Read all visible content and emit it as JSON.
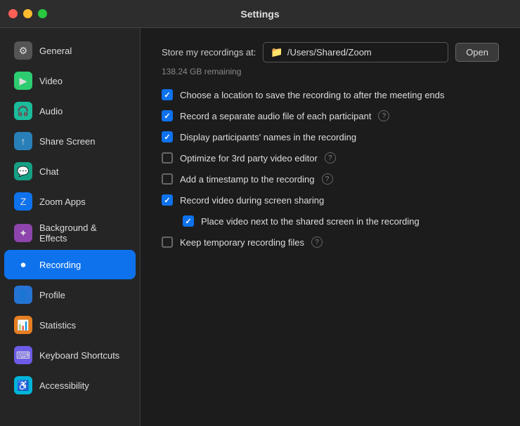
{
  "titleBar": {
    "title": "Settings"
  },
  "sidebar": {
    "items": [
      {
        "id": "general",
        "label": "General",
        "icon": "⚙",
        "iconClass": "icon-gray",
        "active": false
      },
      {
        "id": "video",
        "label": "Video",
        "icon": "▶",
        "iconClass": "icon-green",
        "active": false
      },
      {
        "id": "audio",
        "label": "Audio",
        "icon": "🎧",
        "iconClass": "icon-teal",
        "active": false
      },
      {
        "id": "share-screen",
        "label": "Share Screen",
        "icon": "↑",
        "iconClass": "icon-blue-dark",
        "active": false
      },
      {
        "id": "chat",
        "label": "Chat",
        "icon": "💬",
        "iconClass": "icon-teal2",
        "active": false
      },
      {
        "id": "zoom-apps",
        "label": "Zoom Apps",
        "icon": "Z",
        "iconClass": "icon-blue",
        "active": false
      },
      {
        "id": "background-effects",
        "label": "Background & Effects",
        "icon": "✦",
        "iconClass": "icon-purple",
        "active": false
      },
      {
        "id": "recording",
        "label": "Recording",
        "icon": "⏺",
        "iconClass": "icon-blue",
        "active": true
      },
      {
        "id": "profile",
        "label": "Profile",
        "icon": "👤",
        "iconClass": "icon-blue2",
        "active": false
      },
      {
        "id": "statistics",
        "label": "Statistics",
        "icon": "📊",
        "iconClass": "icon-orange",
        "active": false
      },
      {
        "id": "keyboard-shortcuts",
        "label": "Keyboard Shortcuts",
        "icon": "⌨",
        "iconClass": "icon-violet",
        "active": false
      },
      {
        "id": "accessibility",
        "label": "Accessibility",
        "icon": "♿",
        "iconClass": "icon-cyan",
        "active": false
      }
    ]
  },
  "content": {
    "storageLabel": "Store my recordings at:",
    "storagePath": "/Users/Shared/Zoom",
    "storageRemaining": "138.24 GB remaining",
    "openButton": "Open",
    "options": [
      {
        "id": "opt1",
        "text": "Choose a location to save the recording to after the meeting ends",
        "checked": true,
        "hasHelp": false,
        "indented": false
      },
      {
        "id": "opt2",
        "text": "Record a separate audio file of each participant",
        "checked": true,
        "hasHelp": true,
        "indented": false
      },
      {
        "id": "opt3",
        "text": "Display participants' names in the recording",
        "checked": true,
        "hasHelp": false,
        "indented": false
      },
      {
        "id": "opt4",
        "text": "Optimize for 3rd party video editor",
        "checked": false,
        "hasHelp": true,
        "indented": false
      },
      {
        "id": "opt5",
        "text": "Add a timestamp to the recording",
        "checked": false,
        "hasHelp": true,
        "indented": false
      },
      {
        "id": "opt6",
        "text": "Record video during screen sharing",
        "checked": true,
        "hasHelp": false,
        "indented": false
      },
      {
        "id": "opt7",
        "text": "Place video next to the shared screen in the recording",
        "checked": true,
        "hasHelp": false,
        "indented": true
      },
      {
        "id": "opt8",
        "text": "Keep temporary recording files",
        "checked": false,
        "hasHelp": true,
        "indented": false
      }
    ]
  }
}
